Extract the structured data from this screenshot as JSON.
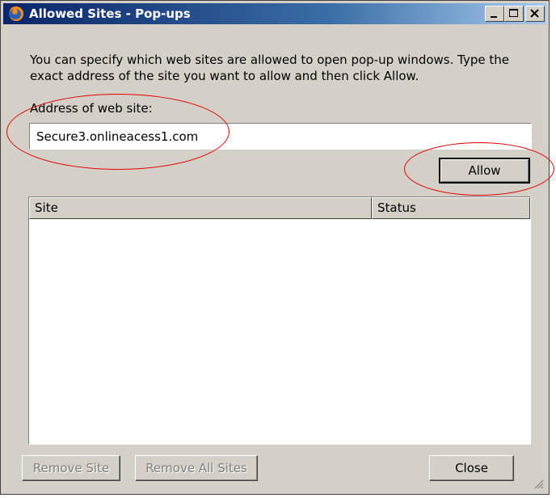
{
  "window": {
    "title": "Allowed Sites - Pop-ups",
    "icon": "firefox-icon",
    "controls": [
      "minimize-icon",
      "maximize-icon",
      "close-icon"
    ]
  },
  "description": "You can specify which web sites are allowed to open pop-up windows. Type the exact address of the site you want to allow and then click Allow.",
  "address": {
    "label": "Address of web site:",
    "value": "Secure3.onlineacess1.com"
  },
  "buttons": {
    "allow": "Allow",
    "remove_site": "Remove Site",
    "remove_all": "Remove All Sites",
    "close": "Close"
  },
  "list": {
    "columns": [
      "Site",
      "Status"
    ],
    "rows": []
  },
  "annotations": {
    "highlight_color": "#e00000"
  }
}
